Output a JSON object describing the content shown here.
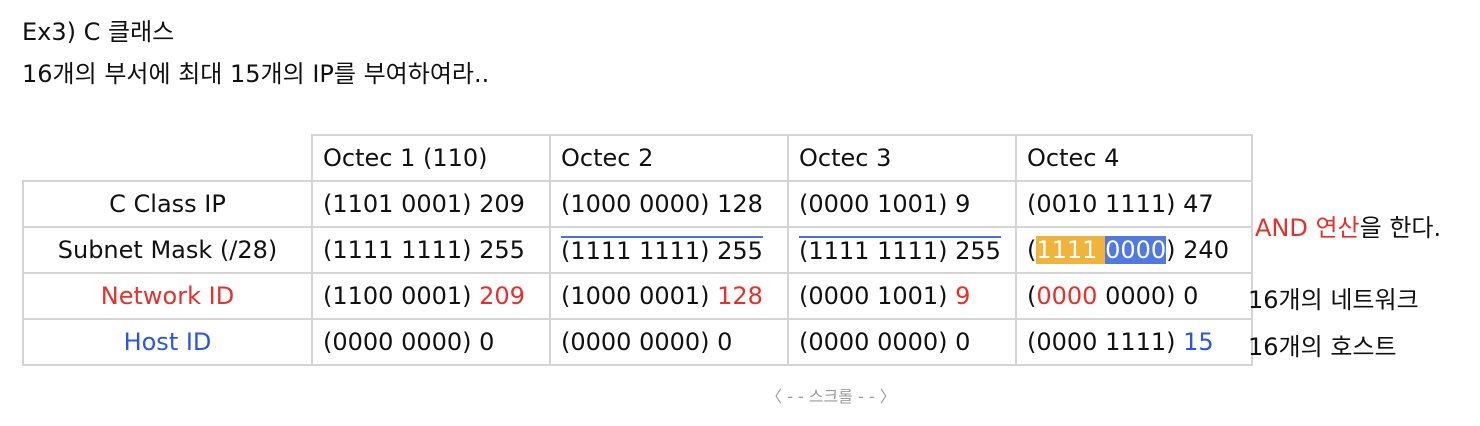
{
  "heading": {
    "line1": "Ex3) C 클래스",
    "line2": "16개의 부서에 최대 15개의 IP를 부여하여라.."
  },
  "table": {
    "headers": [
      "Octec 1 (110)",
      "Octec 2",
      "Octec 3",
      "Octec 4"
    ],
    "rows": {
      "class_ip": {
        "label": "C Class IP",
        "cells": [
          "(1101 0001) 209",
          "(1000 0000) 128",
          "(0000 1001) 9",
          "(0010 1111) 47"
        ]
      },
      "subnet_mask": {
        "label": "Subnet Mask (/28)",
        "cells": [
          "(1111 1111) 255",
          "(1111 1111) 255",
          "(1111 1111) 255"
        ],
        "octet4": {
          "open": "(",
          "highlight_a": "1111",
          "space": " ",
          "highlight_b": "0000",
          "close": ") 240"
        }
      },
      "network_id": {
        "label": "Network ID",
        "o1": {
          "bits": "(1100 0001) ",
          "value": "209"
        },
        "o2": {
          "bits": "(1000 0001) ",
          "value": "128"
        },
        "o3": {
          "bits": "(0000 1001) ",
          "value": "9"
        },
        "o4": {
          "open": "(",
          "red_bits": "0000",
          "rest": " 0000) 0"
        }
      },
      "host_id": {
        "label": "Host ID",
        "cells": [
          "(0000 0000) 0",
          "(0000 0000) 0",
          "(0000 0000) 0"
        ],
        "o4": {
          "bits": "(0000 1111) ",
          "value": "15"
        }
      }
    }
  },
  "side_notes": {
    "and_op": {
      "red_text": "AND 연산",
      "rest": "을 한다."
    },
    "network_count": "16개의 네트워크",
    "host_count": "16개의 호스트"
  },
  "scroll_hint": "〈 - - 스크롤 - - 〉",
  "colors": {
    "red": "#e8302a",
    "blue": "#2a55e6",
    "highlight_yellow": "#f2b33a",
    "highlight_blue": "#5079e3",
    "border": "#d4d4d4"
  }
}
